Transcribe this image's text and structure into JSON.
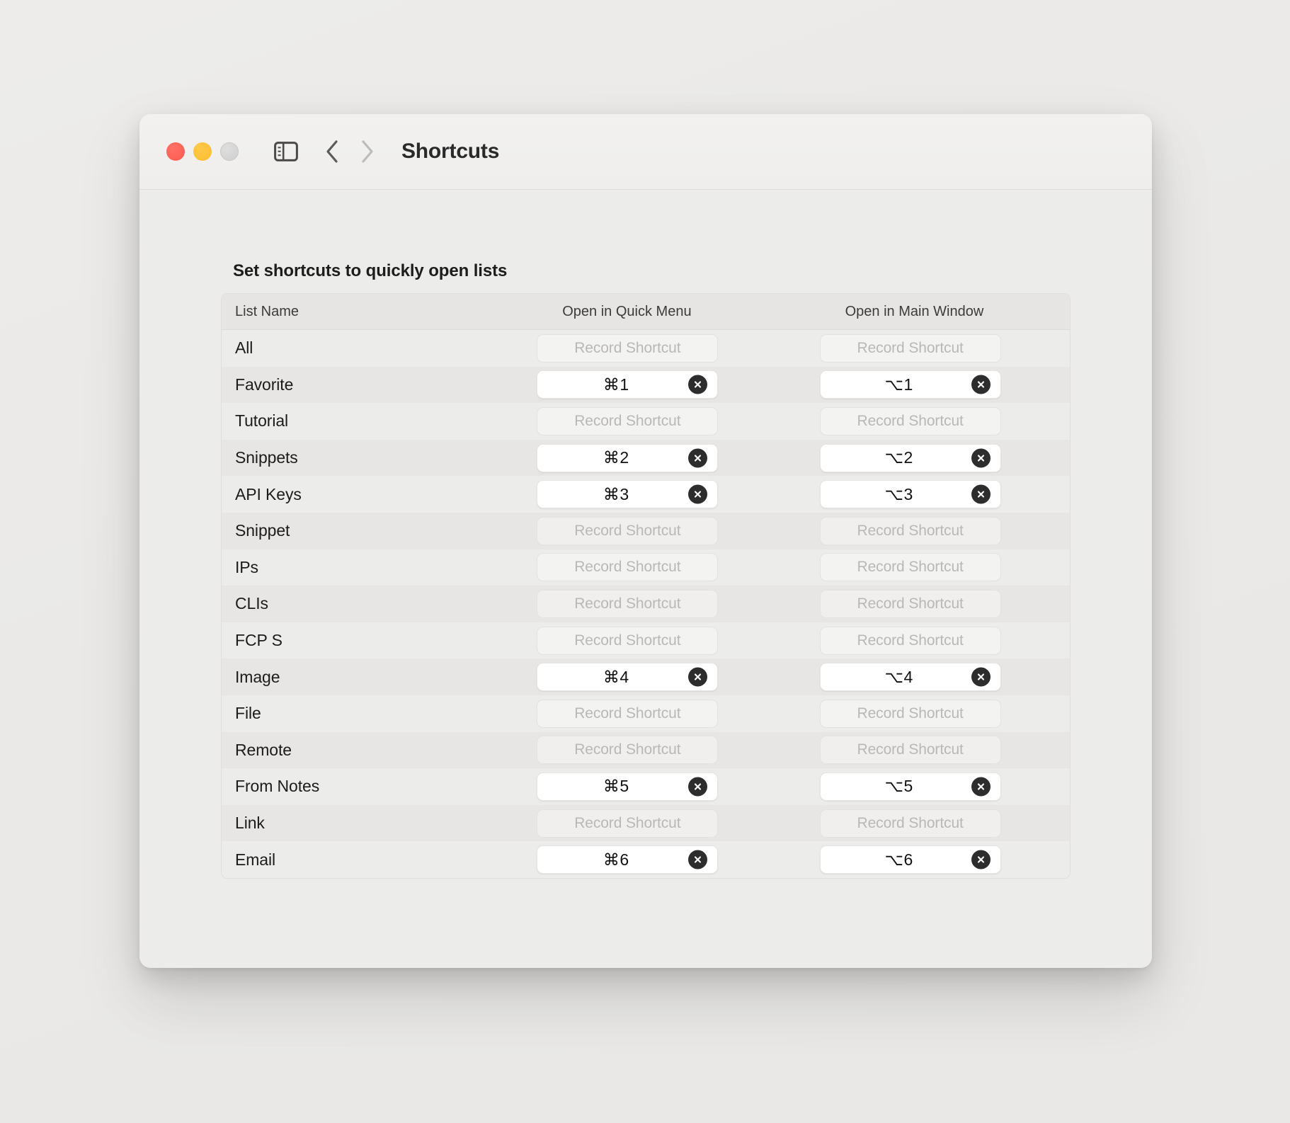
{
  "window": {
    "title": "Shortcuts",
    "traffic_lights": [
      {
        "name": "close",
        "color": "#fc5b50"
      },
      {
        "name": "minimize",
        "color": "#fcbc2f"
      },
      {
        "name": "maximize",
        "color": "#cfcfcf"
      }
    ],
    "toolbar": {
      "sidebar_toggle_icon": "sidebar-toggle-icon",
      "back_icon": "chevron-left-icon",
      "forward_icon": "chevron-right-icon",
      "back_enabled": true,
      "forward_enabled": false
    }
  },
  "main": {
    "section_title": "Set shortcuts to quickly open lists",
    "table": {
      "columns": [
        {
          "key": "name",
          "label": "List Name"
        },
        {
          "key": "quick",
          "label": "Open in Quick Menu"
        },
        {
          "key": "main",
          "label": "Open in Main Window"
        }
      ],
      "record_placeholder": "Record Shortcut",
      "clear_icon": "clear-circle-x-icon",
      "rows": [
        {
          "name": "All",
          "quick": "",
          "main": ""
        },
        {
          "name": "Favorite",
          "quick": "⌘1",
          "main": "⌥1"
        },
        {
          "name": "Tutorial",
          "quick": "",
          "main": ""
        },
        {
          "name": "Snippets",
          "quick": "⌘2",
          "main": "⌥2"
        },
        {
          "name": "API Keys",
          "quick": "⌘3",
          "main": "⌥3"
        },
        {
          "name": "Snippet",
          "quick": "",
          "main": ""
        },
        {
          "name": "IPs",
          "quick": "",
          "main": ""
        },
        {
          "name": "CLIs",
          "quick": "",
          "main": ""
        },
        {
          "name": "FCP S",
          "quick": "",
          "main": ""
        },
        {
          "name": "Image",
          "quick": "⌘4",
          "main": "⌥4"
        },
        {
          "name": "File",
          "quick": "",
          "main": ""
        },
        {
          "name": "Remote",
          "quick": "",
          "main": ""
        },
        {
          "name": "From Notes",
          "quick": "⌘5",
          "main": "⌥5"
        },
        {
          "name": "Link",
          "quick": "",
          "main": ""
        },
        {
          "name": "Email",
          "quick": "⌘6",
          "main": "⌥6"
        }
      ]
    }
  },
  "colors": {
    "window_bg": "#ececea",
    "toolbar_bg": "#f1f0ee",
    "row_odd": "#ececeb",
    "row_even": "#e7e6e4",
    "header_bg": "#e6e5e3",
    "text": "#1c1c1c",
    "placeholder": "#b9b8b6",
    "clear_btn": "#2d2d2d"
  }
}
